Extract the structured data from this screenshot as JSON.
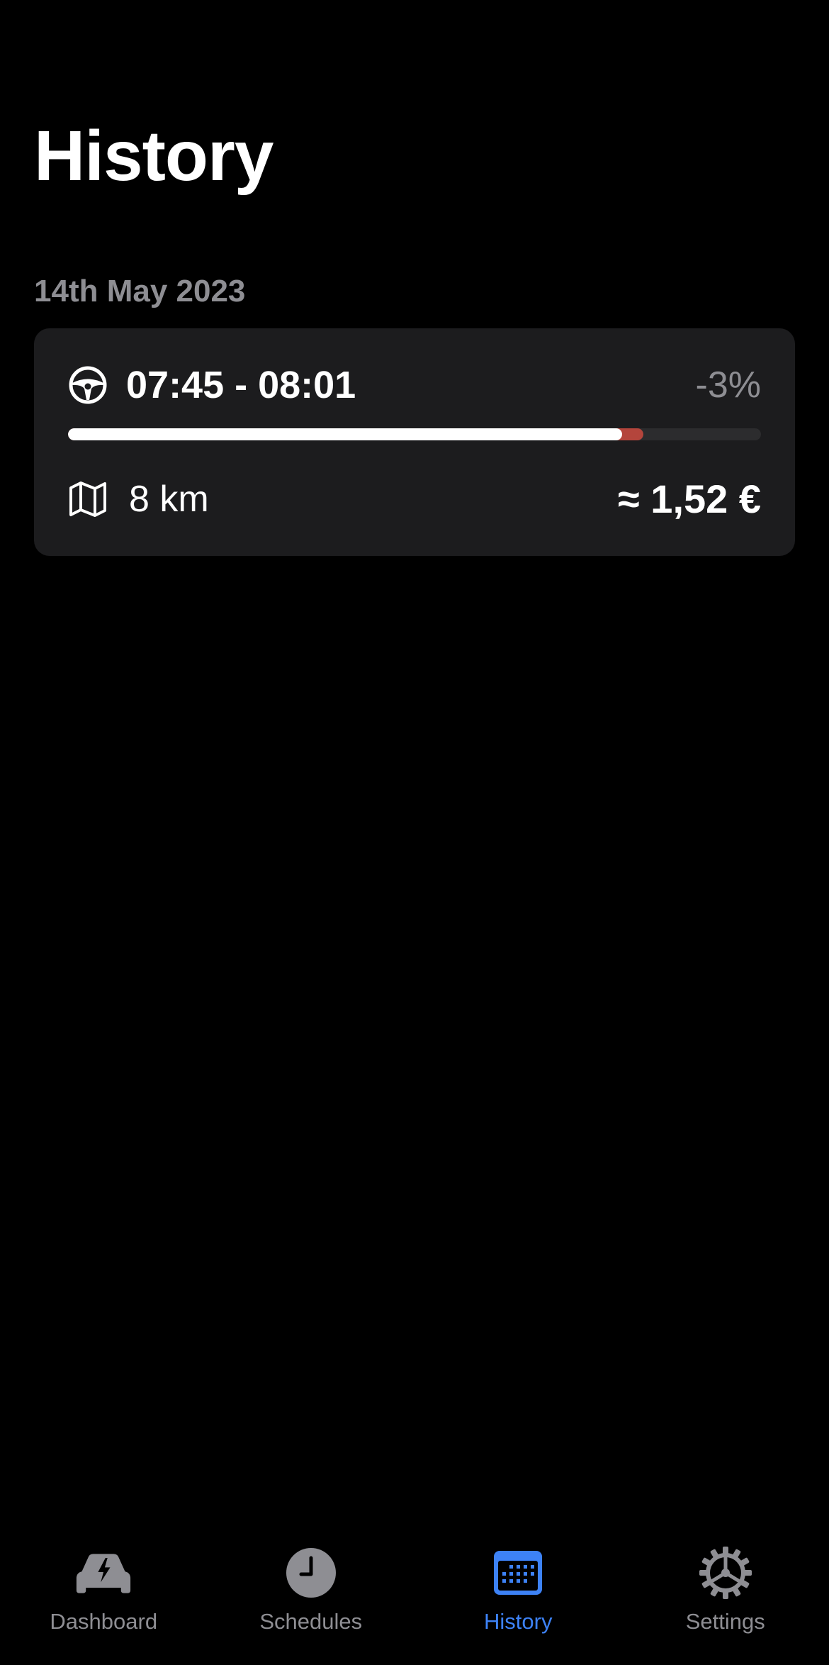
{
  "page": {
    "title": "History"
  },
  "sections": [
    {
      "date": "14th May 2023",
      "trips": [
        {
          "time_range": "07:45 - 08:01",
          "battery_delta": "-3%",
          "battery_level_fraction": 0.8,
          "battery_used_fraction": 0.03,
          "distance": "8 km",
          "cost": "≈ 1,52 €"
        }
      ]
    }
  ],
  "tab_bar": {
    "active": "history",
    "items": [
      {
        "id": "dashboard",
        "label": "Dashboard",
        "icon": "car-bolt-icon"
      },
      {
        "id": "schedules",
        "label": "Schedules",
        "icon": "clock-icon"
      },
      {
        "id": "history",
        "label": "History",
        "icon": "calendar-icon"
      },
      {
        "id": "settings",
        "label": "Settings",
        "icon": "gear-icon"
      }
    ]
  },
  "colors": {
    "background": "#000000",
    "card": "#1c1c1e",
    "secondary_text": "#8e8e93",
    "accent": "#3d82f6",
    "battery_used": "#b4453c",
    "battery_remaining": "#ffffff"
  }
}
